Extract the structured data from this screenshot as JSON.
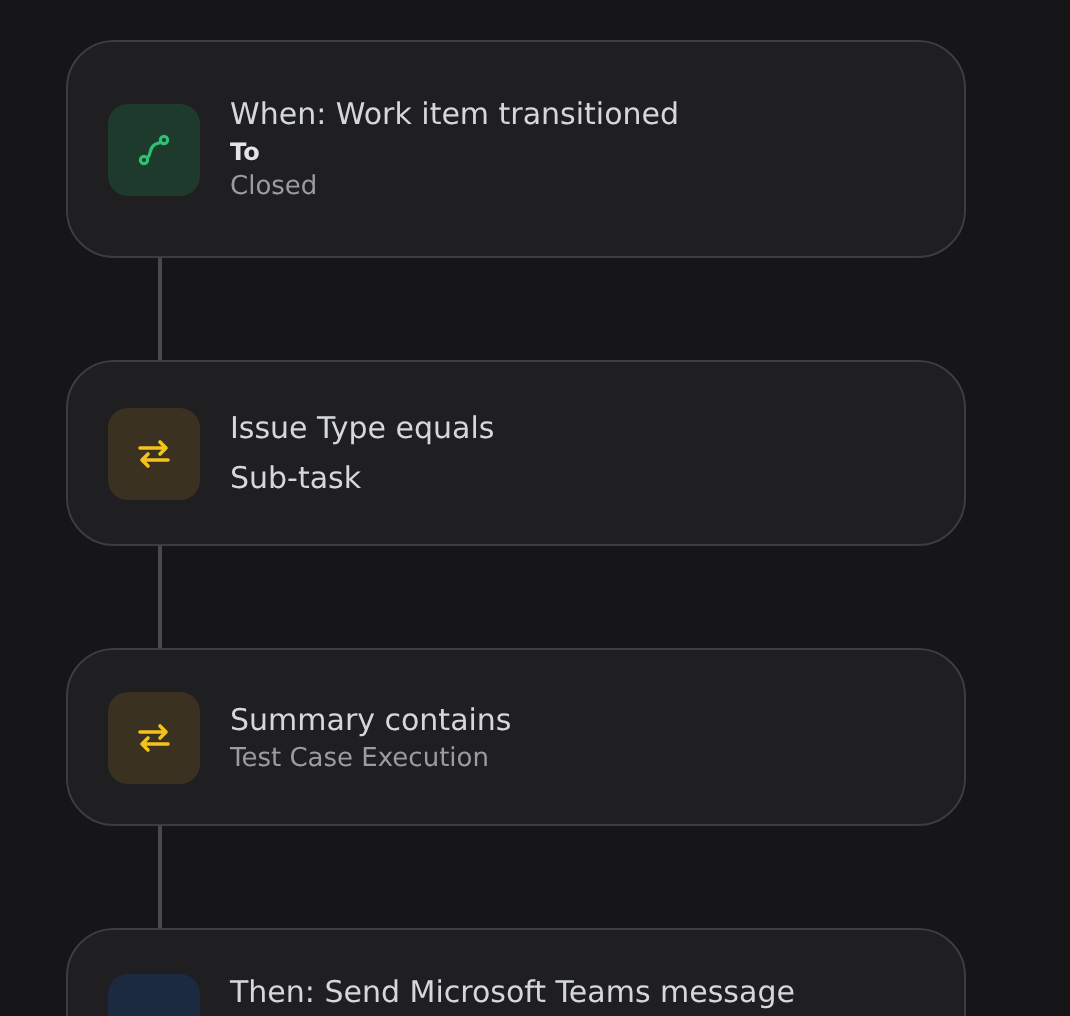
{
  "steps": [
    {
      "kind": "trigger",
      "title": "When: Work item transitioned",
      "lines": [
        {
          "kind": "label",
          "text": "To"
        },
        {
          "kind": "value",
          "text": "Closed"
        }
      ]
    },
    {
      "kind": "condition",
      "title": "Issue Type equals",
      "lines": [
        {
          "kind": "main",
          "text": "Sub-task"
        }
      ]
    },
    {
      "kind": "condition",
      "title": "Summary contains",
      "lines": [
        {
          "kind": "value",
          "text": "Test Case Execution"
        }
      ]
    },
    {
      "kind": "action",
      "title": "Then: Send Microsoft Teams message"
    }
  ]
}
